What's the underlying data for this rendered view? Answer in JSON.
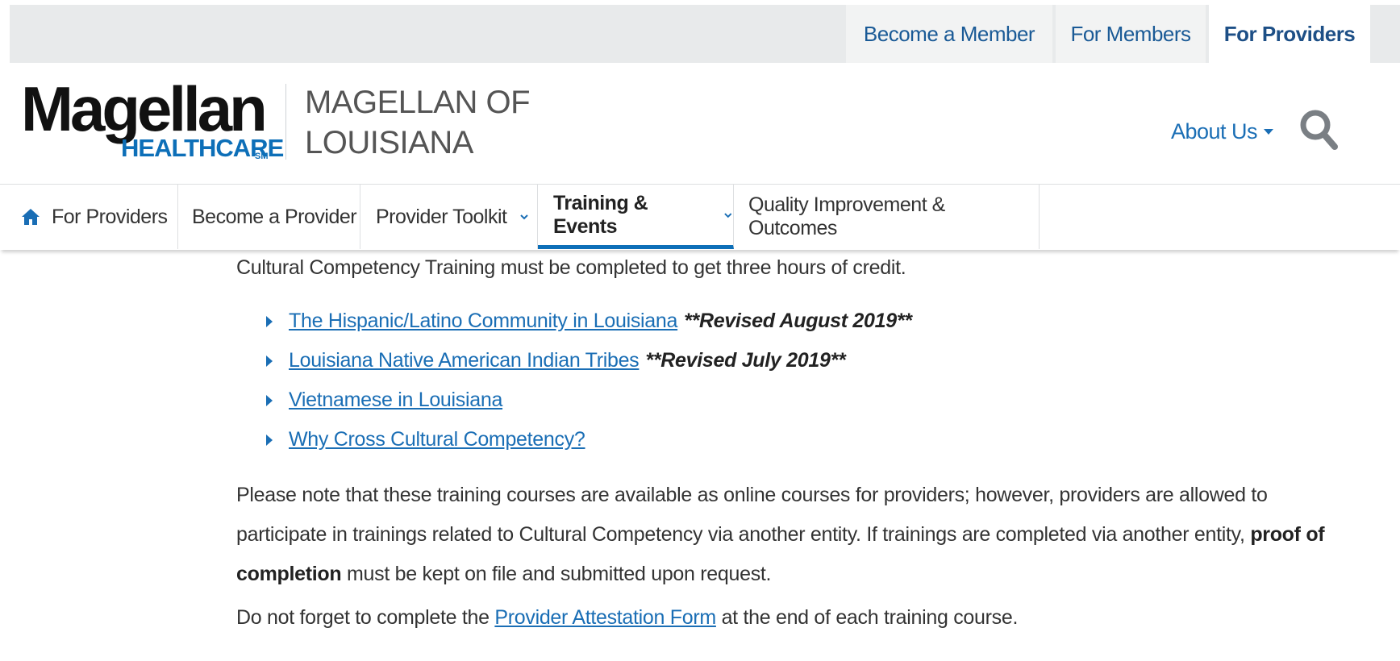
{
  "top_tabs": [
    {
      "label": "Become a Member"
    },
    {
      "label": "For Members"
    },
    {
      "label": "For Providers"
    }
  ],
  "header": {
    "logo_main": "Magellan",
    "logo_sub": "HEALTHCARE",
    "logo_mark": "SM",
    "site_title": "MAGELLAN OF LOUISIANA",
    "about_label": "About Us",
    "search_icon": "search-icon"
  },
  "nav": {
    "items": [
      {
        "label": "For Providers",
        "icon": "home-icon"
      },
      {
        "label": "Become a Provider"
      },
      {
        "label": "Provider Toolkit"
      },
      {
        "label": "Training & Events"
      },
      {
        "label": "Quality Improvement & Outcomes"
      }
    ]
  },
  "content": {
    "intro": "Cultural Competency Training must be completed to get three hours of credit.",
    "links": [
      {
        "text": "The Hispanic/Latino Community in Louisiana",
        "note": "**Revised August 2019**"
      },
      {
        "text": "Louisiana Native American Indian Tribes",
        "note": "**Revised July 2019**"
      },
      {
        "text": "Vietnamese in Louisiana",
        "note": ""
      },
      {
        "text": "Why Cross Cultural Competency?",
        "note": ""
      }
    ],
    "note_para": {
      "before": "Please note that these training courses are available as online courses for providers; however, providers are allowed to participate in trainings related to Cultural Competency via another entity.  If trainings are completed via another entity, ",
      "bold": "proof of completion",
      "after": " must be kept on file and submitted upon request."
    },
    "attest_para": {
      "before": "Do not forget to complete the ",
      "link": "Provider Attestation Form",
      "after": " at the end of each training course."
    }
  },
  "colors": {
    "brand_blue": "#0d6fb8",
    "link_blue": "#1a6eb5",
    "topbar_bg": "#e8eaeb"
  }
}
